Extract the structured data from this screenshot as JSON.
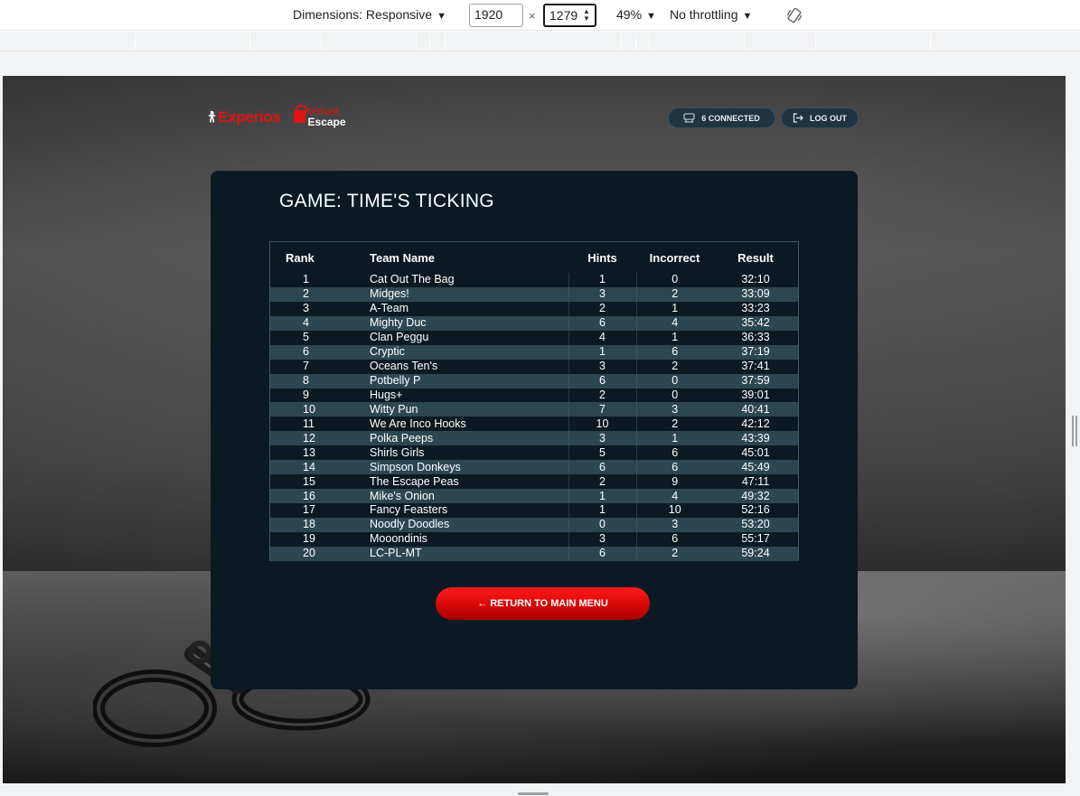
{
  "devtools": {
    "dimensions_label": "Dimensions: Responsive",
    "width_value": "1920",
    "height_value": "1279",
    "times_symbol": "×",
    "zoom": "49%",
    "throttling": "No throttling",
    "caret": "▼",
    "rotate_icon": "rotate-icon"
  },
  "header": {
    "logo_experios": "Experios",
    "logo_virtual": "Virtual",
    "logo_escape": "Escape",
    "connected_label": "6 CONNECTED",
    "logout_label": "LOG OUT"
  },
  "game": {
    "title": "GAME: TIME'S TICKING"
  },
  "leaderboard": {
    "headers": [
      "Rank",
      "Team Name",
      "Hints",
      "Incorrect",
      "Result"
    ],
    "rows": [
      [
        "1",
        "Cat Out The Bag",
        "1",
        "0",
        "32:10"
      ],
      [
        "2",
        "Midges!",
        "3",
        "2",
        "33:09"
      ],
      [
        "3",
        "A-Team",
        "2",
        "1",
        "33:23"
      ],
      [
        "4",
        "Mighty Duc",
        "6",
        "4",
        "35:42"
      ],
      [
        "5",
        "Clan Peggu",
        "4",
        "1",
        "36:33"
      ],
      [
        "6",
        "Cryptic",
        "1",
        "6",
        "37:19"
      ],
      [
        "7",
        "Oceans Ten's",
        "3",
        "2",
        "37:41"
      ],
      [
        "8",
        "Potbelly P",
        "6",
        "0",
        "37:59"
      ],
      [
        "9",
        "Hugs+",
        "2",
        "0",
        "39:01"
      ],
      [
        "10",
        "Witty Pun",
        "7",
        "3",
        "40:41"
      ],
      [
        "11",
        "We Are Inco Hooks",
        "10",
        "2",
        "42:12"
      ],
      [
        "12",
        "Polka Peeps",
        "3",
        "1",
        "43:39"
      ],
      [
        "13",
        "Shirls Girls",
        "5",
        "6",
        "45:01"
      ],
      [
        "14",
        "Simpson Donkeys",
        "6",
        "6",
        "45:49"
      ],
      [
        "15",
        "The Escape Peas",
        "2",
        "9",
        "47:11"
      ],
      [
        "16",
        "Mike's Onion",
        "1",
        "4",
        "49:32"
      ],
      [
        "17",
        "Fancy Feasters",
        "1",
        "10",
        "52:16"
      ],
      [
        "18",
        "Noodly Doodles",
        "0",
        "3",
        "53:20"
      ],
      [
        "19",
        "Mooondinis",
        "3",
        "6",
        "55:17"
      ],
      [
        "20",
        "LC-PL-MT",
        "6",
        "2",
        "59:24"
      ]
    ]
  },
  "actions": {
    "return_arrow": "←",
    "return_label": "RETURN TO MAIN MENU"
  },
  "colors": {
    "accent_red": "#e01212",
    "card_bg": "#0b1a22",
    "row_alt": "#2d4752"
  }
}
